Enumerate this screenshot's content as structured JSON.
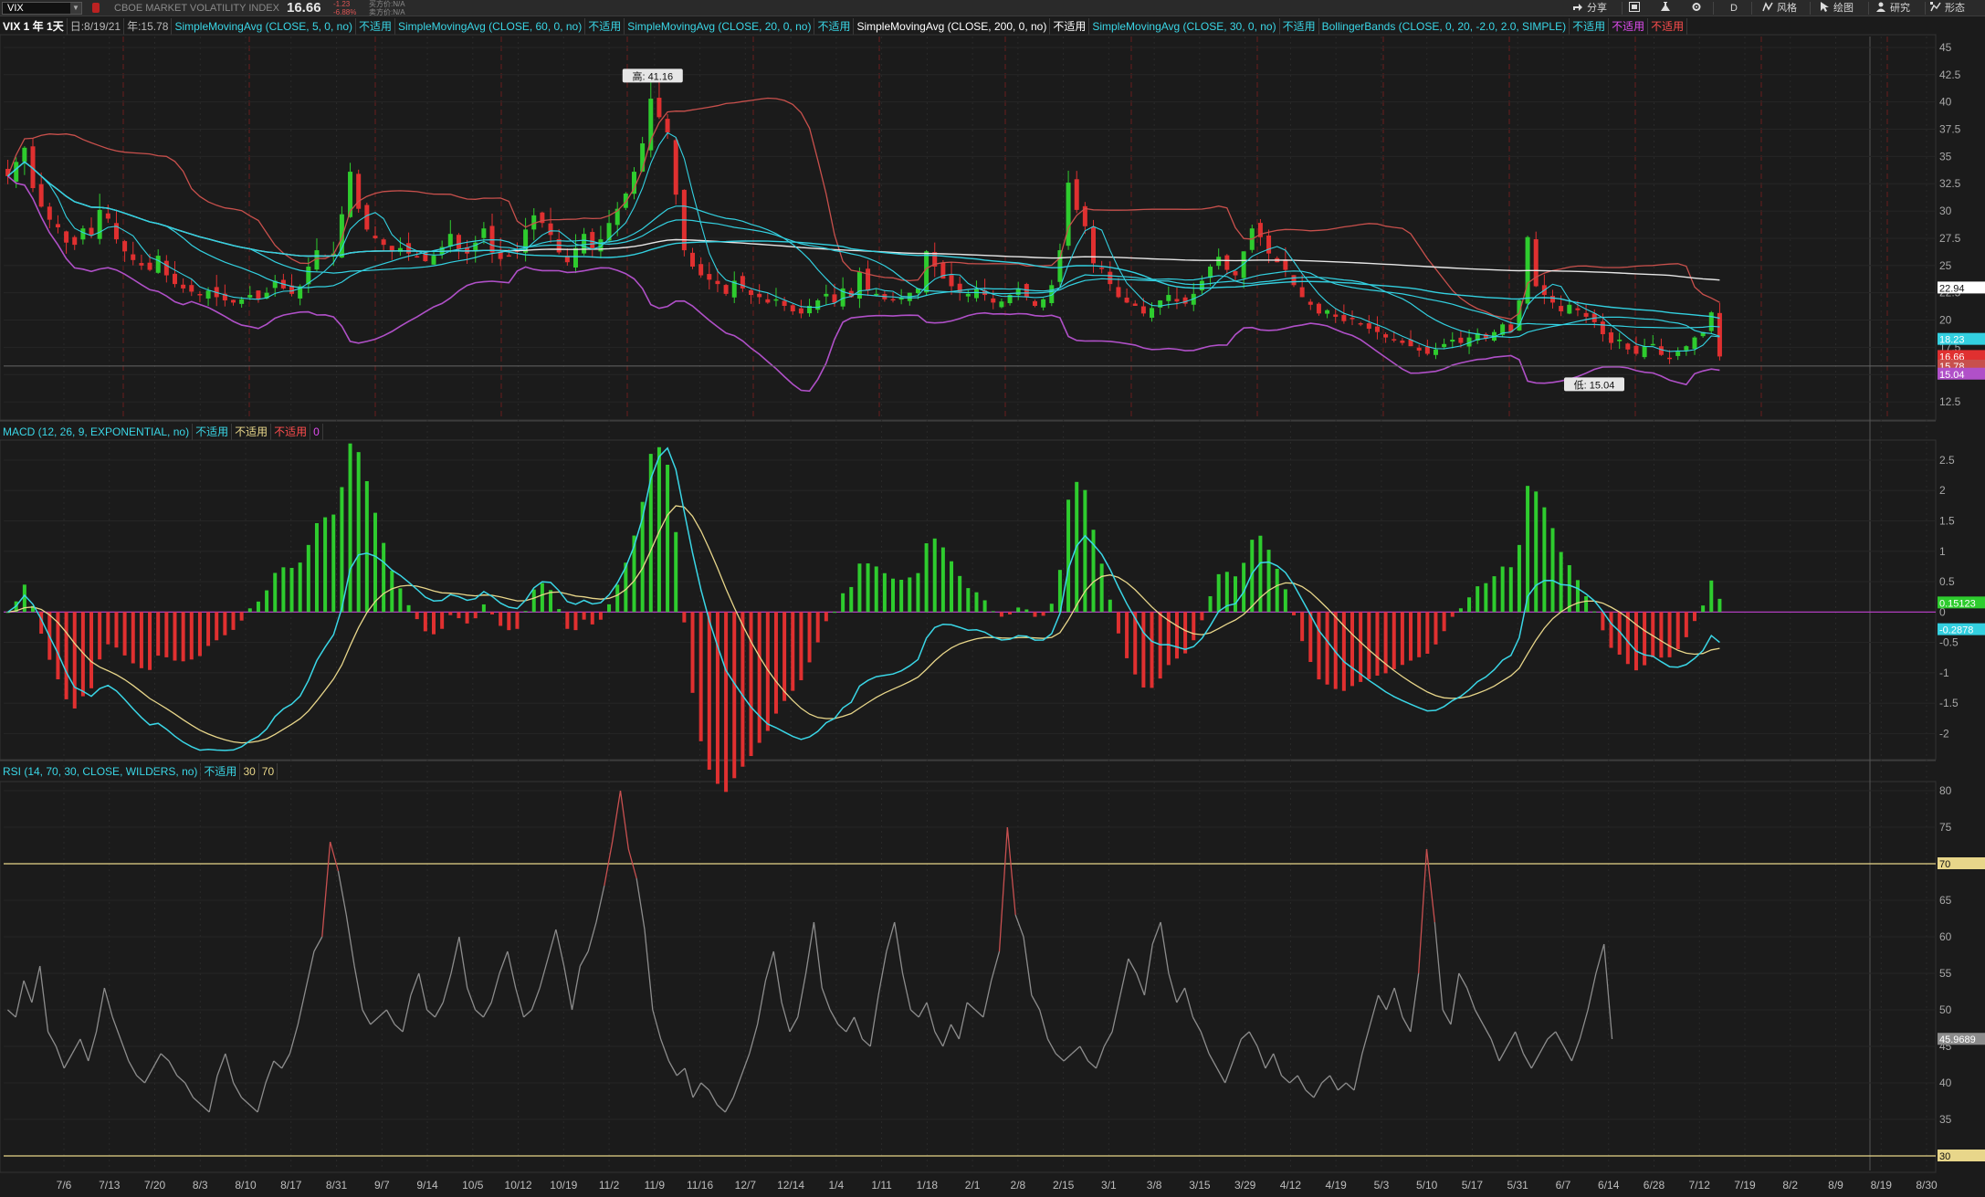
{
  "toolbar": {
    "symbol": "VIX",
    "symbol_title": "CBOE MARKET VOLATILITY INDEX",
    "last_price": "16.66",
    "change_abs": "-1.23",
    "change_pct": "-6.88%",
    "bid": "买方价:N/A",
    "ask": "卖方价:N/A",
    "share_label": "分享",
    "style_label": "风格",
    "drawings_label": "绘图",
    "studies_label": "研究",
    "patterns_label": "形态",
    "aggregation_label": "D"
  },
  "studybar": {
    "timeframe": "VIX 1 年 1天",
    "date_label": "日:8/19/21",
    "year_label": "年:15.78",
    "studies": [
      {
        "name": "SimpleMovingAvg (CLOSE, 5, 0, no)",
        "value": "不适用"
      },
      {
        "name": "SimpleMovingAvg (CLOSE, 60, 0, no)",
        "value": "不适用"
      },
      {
        "name": "SimpleMovingAvg (CLOSE, 20, 0, no)",
        "value": "不适用"
      },
      {
        "name": "SimpleMovingAvg (CLOSE, 200, 0, no)",
        "value": "不适用"
      },
      {
        "name": "SimpleMovingAvg (CLOSE, 30, 0, no)",
        "value": "不适用"
      }
    ],
    "bollinger": {
      "name": "BollingerBands (CLOSE, 0, 20, -2.0, 2.0, SIMPLE)",
      "v1": "不适用",
      "v2": "不适用",
      "v3": "不适用"
    }
  },
  "macd_header": {
    "name": "MACD (12, 26, 9, EXPONENTIAL, no)",
    "v1": "不适用",
    "v2": "不适用",
    "v3": "不适用",
    "v4": "0"
  },
  "rsi_header": {
    "name": "RSI (14, 70, 30, CLOSE, WILDERS, no)",
    "v1": "不适用",
    "v2": "30",
    "v3": "70"
  },
  "colors": {
    "up": "#2ecc2e",
    "down": "#e03030",
    "bb_upper": "#c8504c",
    "bb_lower": "#b050c8",
    "sma200": "#e6e6e6",
    "sma_cyan": "#33d0e0",
    "macd": "#3ad6e6",
    "signal": "#e8d68a",
    "rsi": "#8c8c8c",
    "rsi_ob": "#c85050",
    "level": "#e8d68a",
    "zero": "#c040d0"
  },
  "chart_data": [
    {
      "type": "candlestick",
      "title": "VIX 1 年 1天",
      "x_ticks": [
        "7/6",
        "7/13",
        "7/20",
        "8/3",
        "8/10",
        "8/17",
        "8/31",
        "9/7",
        "9/14",
        "10/5",
        "10/12",
        "10/19",
        "11/2",
        "11/9",
        "11/16",
        "12/7",
        "12/14",
        "1/4",
        "1/11",
        "1/18",
        "2/1",
        "2/8",
        "2/15",
        "3/1",
        "3/8",
        "3/15",
        "3/29",
        "4/12",
        "4/19",
        "5/3",
        "5/10",
        "5/17",
        "5/31",
        "6/7",
        "6/14",
        "6/28",
        "7/12",
        "7/19",
        "8/2",
        "8/9",
        "8/19",
        "8/30"
      ],
      "ylim": [
        11,
        46
      ],
      "y_ticks": [
        12.5,
        15,
        17.5,
        20,
        22.5,
        25,
        27.5,
        30,
        32.5,
        35,
        37.5,
        40,
        42.5,
        45
      ],
      "high_annotation": "高: 41.16",
      "low_annotation": "低: 15.04",
      "price_labels": [
        {
          "text": "22.94",
          "value": 22.94,
          "color": "#ffffff"
        },
        {
          "text": "18.23",
          "value": 18.23,
          "color": "#33d0e0"
        },
        {
          "text": "16.66",
          "value": 16.66,
          "color": "#e03030"
        },
        {
          "text": "15.78",
          "value": 15.78,
          "color": "#c8504c"
        },
        {
          "text": "15.04",
          "value": 15.04,
          "color": "#b050c8"
        }
      ],
      "close_series": [
        33.2,
        34.5,
        35.8,
        32.1,
        30.4,
        29.2,
        28.5,
        27.1,
        26.9,
        28.4,
        27.8,
        30.1,
        29.3,
        27.4,
        26.3,
        25.5,
        25.0,
        24.6,
        25.9,
        24.1,
        23.3,
        22.9,
        22.6,
        22.3,
        22.7,
        22.1,
        21.8,
        21.6,
        21.9,
        22.3,
        21.9,
        22.5,
        23.6,
        22.9,
        22.4,
        23.1,
        24.9,
        26.4,
        25.8,
        26.1,
        29.7,
        33.6,
        30.2,
        28.3,
        27.5,
        26.9,
        26.3,
        26.6,
        26.1,
        25.8,
        25.4,
        25.9,
        26.7,
        27.9,
        26.5,
        26.1,
        27.1,
        28.4,
        26.2,
        25.6,
        25.9,
        26.3,
        28.3,
        29.6,
        28.9,
        27.8,
        26.2,
        25.3,
        26.6,
        27.9,
        26.5,
        27.4,
        28.9,
        30.2,
        31.6,
        33.6,
        36.2,
        40.3,
        38.6,
        37.2,
        31.5,
        26.4,
        24.9,
        24.1,
        23.7,
        23.3,
        22.4,
        23.6,
        22.9,
        22.3,
        22.1,
        21.6,
        21.9,
        21.3,
        20.8,
        20.6,
        21.3,
        21.8,
        22.4,
        21.6,
        22.9,
        22.1,
        24.4,
        22.7,
        22.4,
        21.9,
        21.8,
        22.1,
        22.5,
        22.9,
        26.3,
        24.9,
        23.8,
        23.1,
        22.6,
        22.4,
        22.9,
        22.3,
        21.6,
        21.7,
        22.3,
        22.9,
        22.1,
        21.3,
        21.9,
        23.2,
        26.4,
        32.6,
        30.1,
        28.6,
        25.2,
        24.7,
        23.3,
        22.1,
        21.6,
        21.3,
        20.6,
        21.1,
        21.8,
        22.3,
        21.7,
        21.5,
        22.4,
        23.6,
        24.9,
        25.8,
        24.6,
        24.1,
        26.3,
        28.4,
        27.6,
        26.1,
        25.3,
        24.6,
        23.2,
        22.1,
        21.4,
        20.6,
        20.9,
        20.3,
        19.9,
        20.1,
        19.7,
        19.2,
        18.9,
        18.4,
        18.2,
        17.9,
        17.6,
        17.2,
        16.9,
        17.3,
        17.8,
        18.2,
        17.9,
        18.4,
        18.8,
        18.3,
        18.9,
        19.6,
        18.9,
        21.8,
        27.6,
        23.1,
        22.3,
        21.6,
        20.8,
        21.4,
        20.9,
        20.3,
        19.8,
        18.7,
        17.9,
        18.2,
        17.3,
        16.9,
        17.6,
        17.8,
        16.8,
        16.5,
        17.1,
        17.6,
        18.4,
        18.9,
        20.7,
        16.66
      ],
      "series": [
        {
          "name": "BollingerBands",
          "color_key": "bb_upper"
        },
        {
          "name": "BollingerBands",
          "color_key": "bb_lower"
        },
        {
          "name": "SimpleMovingAvg (CLOSE, 200, 0, no)",
          "color_key": "sma200"
        },
        {
          "name": "SimpleMovingAvg (CLOSE, 20, 0, no)",
          "color_key": "sma_cyan"
        },
        {
          "name": "SimpleMovingAvg (CLOSE, 60, 0, no)",
          "color_key": "sma_cyan"
        }
      ]
    },
    {
      "type": "line+bar",
      "title": "MACD (12, 26, 9, EXPONENTIAL, no)",
      "ylim": [
        -2.4,
        2.8
      ],
      "y_ticks": [
        -2,
        -1.5,
        -1,
        -0.5,
        0,
        0.5,
        1,
        1.5,
        2,
        2.5
      ],
      "price_labels": [
        {
          "text": "0.15123",
          "value": 0.15,
          "color": "#2ecc2e"
        },
        {
          "text": "-0.2878",
          "value": -0.29,
          "color": "#33d0e0"
        }
      ]
    },
    {
      "type": "line",
      "title": "RSI (14, 70, 30, CLOSE, WILDERS, no)",
      "ylim": [
        28,
        81
      ],
      "y_ticks": [
        30,
        35,
        40,
        45,
        50,
        55,
        60,
        65,
        70,
        75,
        80
      ],
      "levels": [
        30,
        70
      ],
      "price_labels": [
        {
          "text": "70",
          "value": 70,
          "color": "#e8d68a"
        },
        {
          "text": "45.9689",
          "value": 45.97,
          "color": "#8c8c8c"
        },
        {
          "text": "30",
          "value": 30,
          "color": "#e8d68a"
        }
      ],
      "rsi_series": [
        50,
        49,
        54,
        51,
        56,
        47,
        45,
        42,
        44,
        46,
        43,
        47,
        53,
        49,
        46,
        43,
        41,
        40,
        42,
        44,
        43,
        41,
        40,
        38,
        37,
        36,
        41,
        44,
        40,
        38,
        37,
        36,
        40,
        43,
        42,
        44,
        48,
        53,
        58,
        60,
        73,
        69,
        63,
        56,
        50,
        48,
        49,
        50,
        48,
        47,
        52,
        55,
        50,
        49,
        51,
        55,
        60,
        53,
        50,
        49,
        51,
        55,
        58,
        53,
        49,
        50,
        53,
        57,
        61,
        56,
        50,
        56,
        58,
        62,
        67,
        73,
        80,
        72,
        68,
        61,
        50,
        46,
        43,
        41,
        42,
        38,
        40,
        39,
        37,
        36,
        38,
        41,
        44,
        48,
        54,
        58,
        51,
        47,
        49,
        55,
        62,
        53,
        50,
        48,
        47,
        49,
        46,
        45,
        52,
        58,
        62,
        55,
        50,
        49,
        51,
        47,
        45,
        48,
        46,
        51,
        50,
        49,
        54,
        58,
        75,
        63,
        60,
        52,
        50,
        46,
        44,
        43,
        44,
        45,
        43,
        42,
        45,
        47,
        52,
        57,
        55,
        52,
        59,
        62,
        55,
        51,
        53,
        49,
        47,
        44,
        42,
        40,
        43,
        46,
        47,
        45,
        42,
        44,
        41,
        40,
        41,
        39,
        38,
        40,
        41,
        39,
        40,
        39,
        44,
        48,
        52,
        50,
        53,
        49,
        47,
        55,
        72,
        62,
        50,
        48,
        55,
        53,
        50,
        48,
        46,
        43,
        45,
        47,
        44,
        42,
        44,
        46,
        47,
        45,
        43,
        46,
        50,
        55,
        59,
        46
      ]
    }
  ]
}
